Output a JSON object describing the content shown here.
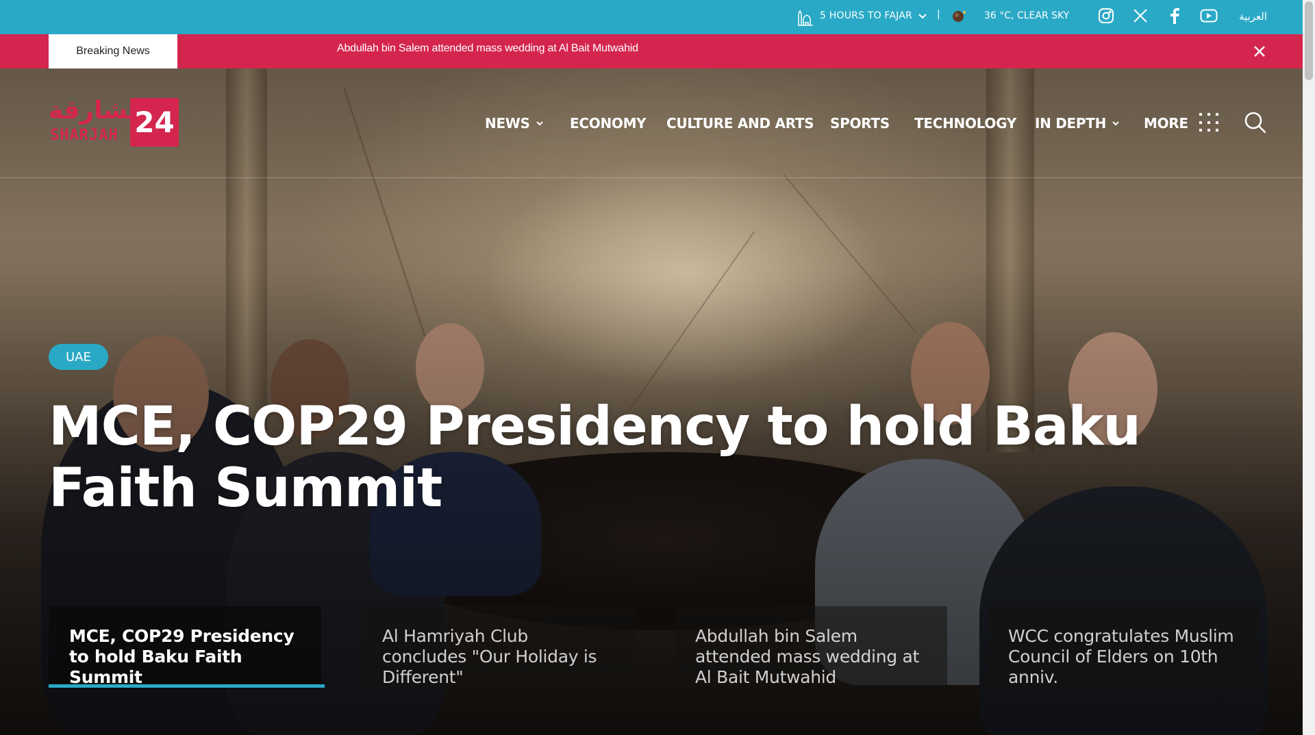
{
  "topbar": {
    "prayer_text": "5 HOURS TO FAJAR",
    "separator": "|",
    "weather_text": "36 °C, CLEAR SKY",
    "language_link": "العربية",
    "social": [
      "instagram-icon",
      "x-icon",
      "facebook-icon",
      "youtube-icon"
    ],
    "bg_color": "#29a9c6"
  },
  "breaking": {
    "label": "Breaking News",
    "text": "Abdullah bin Salem attended mass wedding at Al Bait Mutwahid",
    "bg_color": "#d4254e"
  },
  "logo": {
    "arabic": "الشارقة",
    "english": "SHARJAH",
    "number": "24"
  },
  "nav": {
    "items": [
      {
        "label": "NEWS",
        "dropdown": true
      },
      {
        "label": "ECONOMY",
        "dropdown": false
      },
      {
        "label": "CULTURE AND ARTS",
        "dropdown": false
      },
      {
        "label": "SPORTS",
        "dropdown": false
      },
      {
        "label": "TECHNOLOGY",
        "dropdown": false
      },
      {
        "label": "IN DEPTH",
        "dropdown": true
      },
      {
        "label": "MORE",
        "dropdown": false
      }
    ]
  },
  "hero": {
    "tag": "UAE",
    "headline": "MCE, COP29 Presidency to hold Baku Faith Summit"
  },
  "stories": [
    {
      "title": "MCE, COP29 Presidency to hold Baku Faith Summit",
      "active": true
    },
    {
      "title": "Al Hamriyah Club concludes \"Our Holiday is Different\"",
      "active": false
    },
    {
      "title": "Abdullah bin Salem attended mass wedding at Al Bait Mutwahid",
      "active": false
    },
    {
      "title": "WCC congratulates Muslim Council of Elders on 10th anniv.",
      "active": false
    }
  ]
}
